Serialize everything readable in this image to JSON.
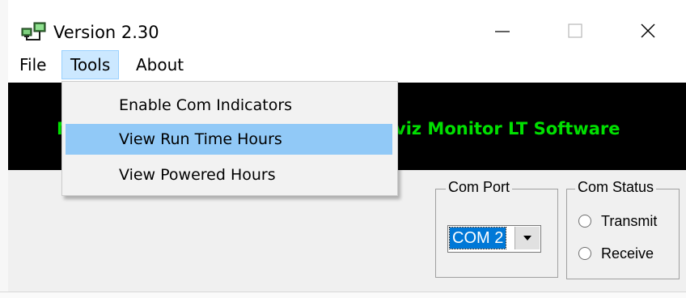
{
  "window": {
    "title": "Version 2.30",
    "icon": "app-network-icon",
    "controls": {
      "minimize": "minimize-icon",
      "maximize": "maximize-icon",
      "close": "close-icon"
    }
  },
  "menubar": {
    "items": [
      {
        "label": "File"
      },
      {
        "label": "Tools",
        "active": true
      },
      {
        "label": "About"
      }
    ]
  },
  "tools_menu": {
    "items": [
      {
        "label": "Enable Com Indicators"
      },
      {
        "label": "View Run Time Hours",
        "highlighted": true
      },
      {
        "label": "View Powered Hours"
      }
    ]
  },
  "banner": {
    "left_text": "M",
    "right_text": "viz Monitor LT Software",
    "text_color": "#00e000",
    "background": "#000000"
  },
  "com_port": {
    "label": "Com Port",
    "selected": "COM 2"
  },
  "com_status": {
    "label": "Com Status",
    "options": [
      {
        "label": "Transmit"
      },
      {
        "label": "Receive"
      }
    ]
  },
  "colors": {
    "menu_highlight": "#91c9f7",
    "menubar_active": "#cce8ff",
    "selection": "#0078d7"
  }
}
